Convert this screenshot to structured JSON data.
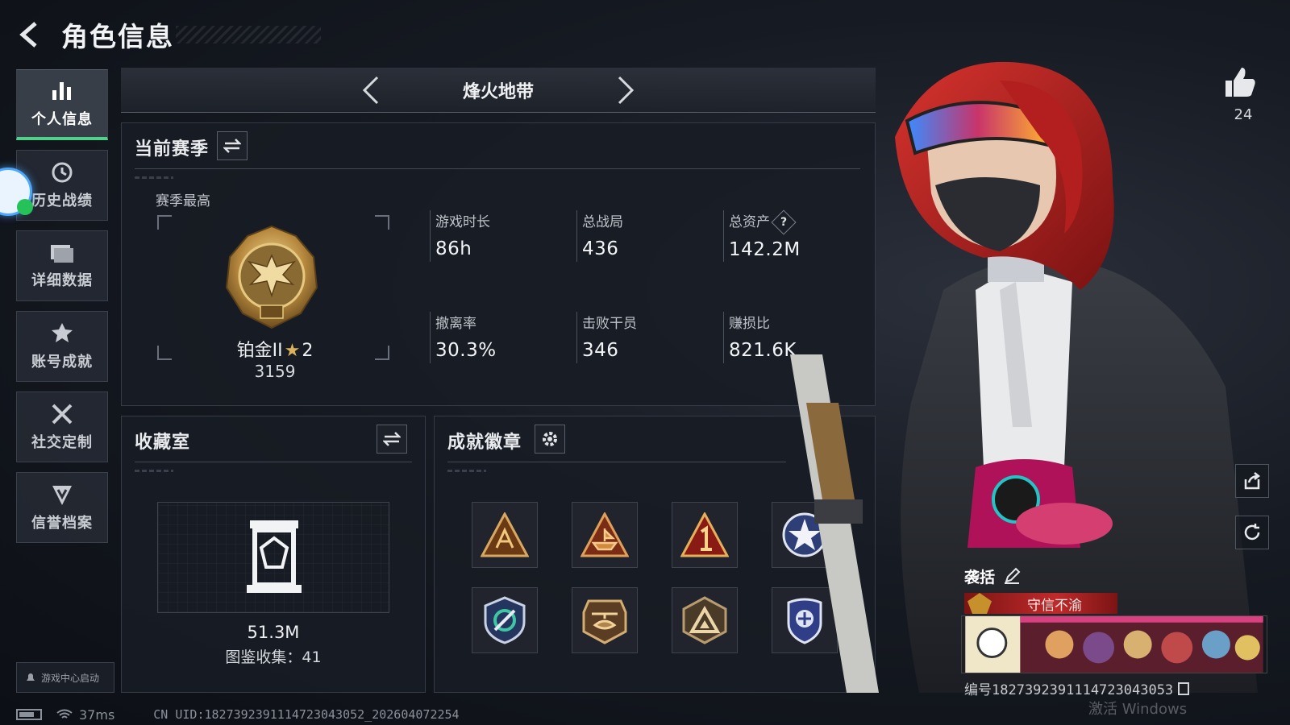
{
  "header": {
    "title": "角色信息"
  },
  "sidebar": {
    "items": [
      {
        "label": "个人信息",
        "icon": "bar-chart-icon",
        "active": true
      },
      {
        "label": "历史战绩",
        "icon": "history-clock-icon",
        "active": false
      },
      {
        "label": "详细数据",
        "icon": "folder-icon",
        "active": false
      },
      {
        "label": "账号成就",
        "icon": "achievement-icon",
        "active": false
      },
      {
        "label": "社交定制",
        "icon": "tools-icon",
        "active": false
      },
      {
        "label": "信誉档案",
        "icon": "credit-shield-icon",
        "active": false
      }
    ],
    "launcher_label": "游戏中心启动"
  },
  "mode_selector": {
    "current": "烽火地带"
  },
  "season": {
    "title": "当前赛季",
    "peak_label": "赛季最高",
    "rank_name": "铂金II",
    "rank_stars": "2",
    "rank_score": "3159",
    "stats": [
      {
        "label": "游戏时长",
        "value": "86h"
      },
      {
        "label": "总战局",
        "value": "436"
      },
      {
        "label": "总资产",
        "value": "142.2M",
        "help": "?"
      },
      {
        "label": "撤离率",
        "value": "30.3%"
      },
      {
        "label": "击败干员",
        "value": "346"
      },
      {
        "label": "赚损比",
        "value": "821.6K"
      }
    ]
  },
  "collection": {
    "title": "收藏室",
    "value": "51.3M",
    "count_label": "图鉴收集：",
    "count": "41"
  },
  "badges": {
    "title": "成就徽章",
    "items": [
      "squad-badge-icon",
      "ship-badge-icon",
      "rank-one-badge-icon",
      "star-seal-badge-icon",
      "satellite-shield-badge-icon",
      "helicopter-badge-icon",
      "triangle-badge-icon",
      "police-badge-icon"
    ]
  },
  "profile": {
    "likes": "24",
    "player_name": "袭括",
    "title_badge": "守信不渝",
    "player_id": "编号1827392391114723043053"
  },
  "status_bar": {
    "ping": "37ms",
    "uid": "CN UID:1827392391114723043052_202604072254"
  },
  "watermark": "激活 Windows",
  "colors": {
    "accent_active": "#4fd18a",
    "title_badge_red": "#c02a2a",
    "gold": "#d9b25a"
  }
}
